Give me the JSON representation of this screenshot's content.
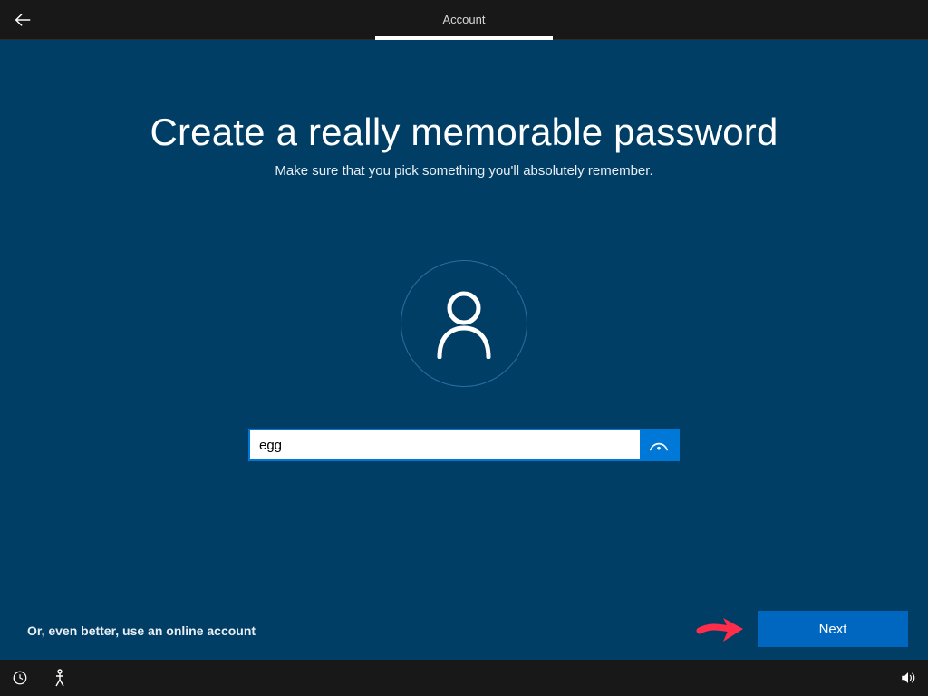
{
  "header": {
    "tab_label": "Account"
  },
  "page": {
    "title": "Create a really memorable password",
    "subtitle": "Make sure that you pick something you'll absolutely remember.",
    "password_value": "egg",
    "online_account_link": "Or, even better, use an online account",
    "next_button": "Next"
  }
}
